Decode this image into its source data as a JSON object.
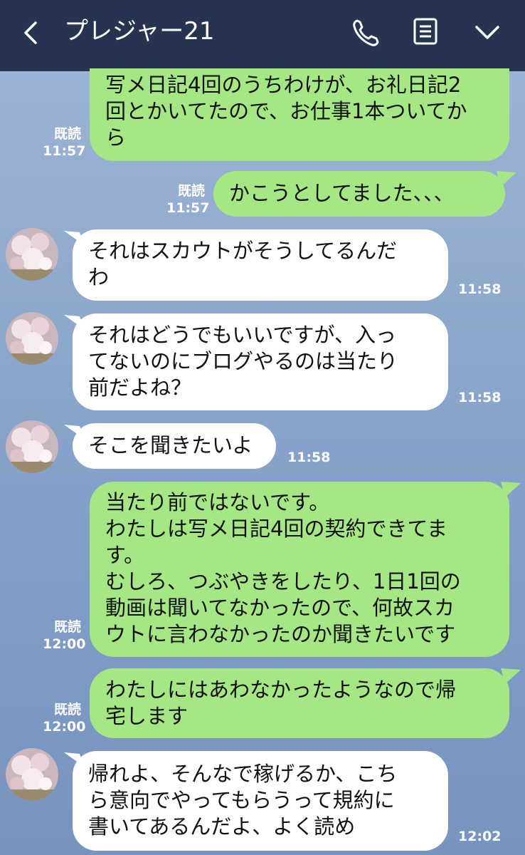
{
  "header": {
    "title": "プレジャー21",
    "icons": [
      "back-arrow-icon",
      "phone-icon",
      "notes-icon",
      "chevron-down-icon"
    ]
  },
  "colors": {
    "header_bg": "#27344f",
    "sent_bubble": "#a5e784",
    "received_bubble": "#ffffff",
    "chat_bg": "#8aa4c8"
  },
  "messages": [
    {
      "direction": "sent",
      "lines": [
        "写メ日記4回のうちわけが、お礼日記2",
        "回とかいてたので、お仕事1本ついてか",
        "ら"
      ],
      "read": "既読",
      "time": "11:57"
    },
    {
      "direction": "sent",
      "lines": [
        "かこうとしてました、、、"
      ],
      "read": "既読",
      "time": "11:57"
    },
    {
      "direction": "received",
      "lines": [
        "それはスカウトがそうしてるんだ",
        "わ"
      ],
      "time": "11:58"
    },
    {
      "direction": "received",
      "lines": [
        "それはどうでもいいですが、入っ",
        "てないのにブログやるのは当たり",
        "前だよね？"
      ],
      "time": "11:58"
    },
    {
      "direction": "received",
      "lines": [
        "そこを聞きたいよ"
      ],
      "time": "11:58"
    },
    {
      "direction": "sent",
      "lines": [
        "当たり前ではないです。",
        "わたしは写メ日記4回の契約できてま",
        "す。",
        "むしろ、つぶやきをしたり、1日1回の",
        "動画は聞いてなかったので、何故スカ",
        "ウトに言わなかったのか聞きたいです"
      ],
      "read": "既読",
      "time": "12:00"
    },
    {
      "direction": "sent",
      "lines": [
        "わたしにはあわなかったようなので帰",
        "宅します"
      ],
      "read": "既読",
      "time": "12:00"
    },
    {
      "direction": "received",
      "lines": [
        "帰れよ、そんなで稼げるか、こち",
        "ら意向でやってもらうって規約に",
        "書いてあるんだよ、よく読め"
      ],
      "time": "12:02"
    }
  ]
}
